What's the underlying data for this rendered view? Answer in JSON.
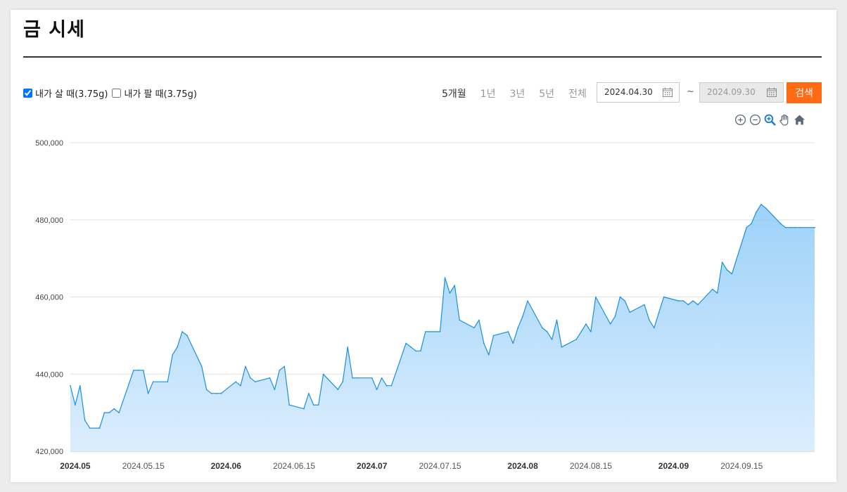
{
  "title": "금 시세",
  "filters": {
    "buy_label": "내가 살 때(3.75g)",
    "buy_checked": true,
    "sell_label": "내가 팔 때(3.75g)",
    "sell_checked": false
  },
  "periods": [
    "5개월",
    "1년",
    "3년",
    "5년",
    "전체"
  ],
  "active_period": "5개월",
  "date_from": "2024.04.30",
  "tilde": "~",
  "date_to": "2024.09.30",
  "search_label": "검색",
  "colors": {
    "accent": "#ff6a13",
    "line": "#1a8fe0",
    "fill": "#a8d6fb"
  },
  "chart_tools": [
    "zoom-in-icon",
    "zoom-out-icon",
    "zoom-select-icon",
    "pan-hand-icon",
    "reset-home-icon"
  ],
  "chart_data": {
    "type": "area",
    "ylim": [
      420000,
      500000
    ],
    "yticks": [
      "420,000",
      "440,000",
      "460,000",
      "480,000",
      "500,000"
    ],
    "xticks": [
      {
        "label": "2024.05",
        "bold": true,
        "x": "2024-05-01"
      },
      {
        "label": "2024.05.15",
        "bold": false,
        "x": "2024-05-15"
      },
      {
        "label": "2024.06",
        "bold": true,
        "x": "2024-06-01"
      },
      {
        "label": "2024.06.15",
        "bold": false,
        "x": "2024-06-15"
      },
      {
        "label": "2024.07",
        "bold": true,
        "x": "2024-07-01"
      },
      {
        "label": "2024.07.15",
        "bold": false,
        "x": "2024-07-15"
      },
      {
        "label": "2024.08",
        "bold": true,
        "x": "2024-08-01"
      },
      {
        "label": "2024.08.15",
        "bold": false,
        "x": "2024-08-15"
      },
      {
        "label": "2024.09",
        "bold": true,
        "x": "2024-09-01"
      },
      {
        "label": "2024.09.15",
        "bold": false,
        "x": "2024-09-15"
      }
    ],
    "x": [
      "2024-04-30",
      "2024-05-01",
      "2024-05-02",
      "2024-05-03",
      "2024-05-04",
      "2024-05-06",
      "2024-05-07",
      "2024-05-08",
      "2024-05-09",
      "2024-05-10",
      "2024-05-13",
      "2024-05-14",
      "2024-05-15",
      "2024-05-16",
      "2024-05-17",
      "2024-05-20",
      "2024-05-21",
      "2024-05-22",
      "2024-05-23",
      "2024-05-24",
      "2024-05-27",
      "2024-05-28",
      "2024-05-29",
      "2024-05-30",
      "2024-05-31",
      "2024-06-03",
      "2024-06-04",
      "2024-06-05",
      "2024-06-06",
      "2024-06-07",
      "2024-06-10",
      "2024-06-11",
      "2024-06-12",
      "2024-06-13",
      "2024-06-14",
      "2024-06-17",
      "2024-06-18",
      "2024-06-19",
      "2024-06-20",
      "2024-06-21",
      "2024-06-24",
      "2024-06-25",
      "2024-06-26",
      "2024-06-27",
      "2024-06-28",
      "2024-07-01",
      "2024-07-02",
      "2024-07-03",
      "2024-07-04",
      "2024-07-05",
      "2024-07-08",
      "2024-07-09",
      "2024-07-10",
      "2024-07-11",
      "2024-07-12",
      "2024-07-15",
      "2024-07-16",
      "2024-07-17",
      "2024-07-18",
      "2024-07-19",
      "2024-07-22",
      "2024-07-23",
      "2024-07-24",
      "2024-07-25",
      "2024-07-26",
      "2024-07-29",
      "2024-07-30",
      "2024-07-31",
      "2024-08-01",
      "2024-08-02",
      "2024-08-05",
      "2024-08-06",
      "2024-08-07",
      "2024-08-08",
      "2024-08-09",
      "2024-08-12",
      "2024-08-13",
      "2024-08-14",
      "2024-08-15",
      "2024-08-16",
      "2024-08-19",
      "2024-08-20",
      "2024-08-21",
      "2024-08-22",
      "2024-08-23",
      "2024-08-26",
      "2024-08-27",
      "2024-08-28",
      "2024-08-29",
      "2024-08-30",
      "2024-09-02",
      "2024-09-03",
      "2024-09-04",
      "2024-09-05",
      "2024-09-06",
      "2024-09-09",
      "2024-09-10",
      "2024-09-11",
      "2024-09-12",
      "2024-09-13",
      "2024-09-16",
      "2024-09-17",
      "2024-09-18",
      "2024-09-19",
      "2024-09-20",
      "2024-09-23",
      "2024-09-24",
      "2024-09-25",
      "2024-09-26",
      "2024-09-27",
      "2024-09-30"
    ],
    "series": [
      {
        "values": [
          437000,
          432000,
          437000,
          428000,
          426000,
          426000,
          430000,
          430000,
          431000,
          430000,
          441000,
          441000,
          441000,
          435000,
          438000,
          438000,
          445000,
          447000,
          451000,
          450000,
          442000,
          436000,
          435000,
          435000,
          435000,
          438000,
          437000,
          442000,
          439000,
          438000,
          439000,
          436000,
          441000,
          442000,
          432000,
          431000,
          435000,
          432000,
          432000,
          440000,
          436000,
          438000,
          447000,
          439000,
          439000,
          439000,
          436000,
          439000,
          437000,
          437000,
          448000,
          447000,
          446000,
          446000,
          451000,
          451000,
          465000,
          461000,
          463000,
          454000,
          452000,
          454000,
          448000,
          445000,
          450000,
          451000,
          448000,
          452000,
          455000,
          459000,
          452000,
          451000,
          449000,
          454000,
          447000,
          449000,
          451000,
          453000,
          451000,
          460000,
          453000,
          455000,
          460000,
          459000,
          456000,
          458000,
          454000,
          452000,
          456000,
          460000,
          459000,
          459000,
          458000,
          459000,
          458000,
          462000,
          461000,
          469000,
          467000,
          466000,
          478000,
          479000,
          482000,
          484000,
          483000,
          479000,
          478000,
          478000,
          478000,
          478000,
          478000
        ]
      }
    ]
  }
}
